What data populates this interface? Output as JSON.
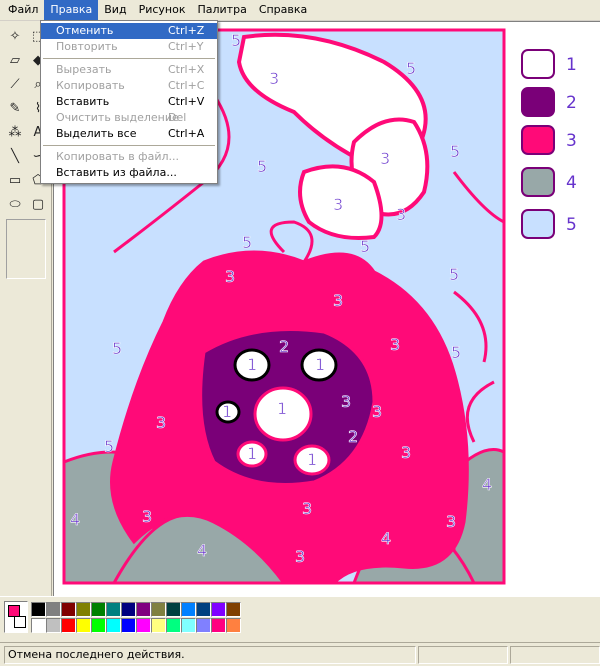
{
  "menubar": {
    "items": [
      "Файл",
      "Правка",
      "Вид",
      "Рисунок",
      "Палитра",
      "Справка"
    ]
  },
  "edit_menu": {
    "items": [
      {
        "label": "Отменить",
        "shortcut": "Ctrl+Z"
      },
      {
        "label": "Повторить",
        "shortcut": "Ctrl+Y"
      },
      {
        "label": "Вырезать",
        "shortcut": "Ctrl+X"
      },
      {
        "label": "Копировать",
        "shortcut": "Ctrl+C"
      },
      {
        "label": "Вставить",
        "shortcut": "Ctrl+V"
      },
      {
        "label": "Очистить выделение",
        "shortcut": "Del"
      },
      {
        "label": "Выделить все",
        "shortcut": "Ctrl+A"
      },
      {
        "label": "Копировать в файл..."
      },
      {
        "label": "Вставить из файла..."
      }
    ]
  },
  "tools": {
    "icons": [
      "free-select-icon",
      "rect-select-icon",
      "eraser-icon",
      "fill-icon",
      "color-picker-icon",
      "magnifier-icon",
      "pencil-icon",
      "brush-icon",
      "airbrush-icon",
      "text-icon",
      "line-icon",
      "curve-icon",
      "rectangle-icon",
      "polygon-icon",
      "ellipse-icon",
      "rounded-rect-icon"
    ]
  },
  "legend": {
    "labels": [
      "1",
      "2",
      "3",
      "4",
      "5"
    ],
    "colors": [
      "#ffffff",
      "#7a0078",
      "#ff0a78",
      "#98a8a8",
      "#c8e0ff"
    ]
  },
  "picture": {
    "colors": {
      "one": "#ffffff",
      "two": "#7a0078",
      "three": "#ff0a78",
      "four": "#98a8a8",
      "five": "#c8e0ff",
      "outline": "#ff0a78",
      "number": "#6633cc"
    },
    "number_labels": [
      "5",
      "5",
      "3",
      "3",
      "5",
      "5",
      "3",
      "3",
      "5",
      "3",
      "5",
      "5",
      "3",
      "5",
      "3",
      "5",
      "3",
      "3",
      "1",
      "2",
      "1",
      "3",
      "1",
      "1",
      "3",
      "2",
      "1",
      "1",
      "5",
      "3",
      "3",
      "4",
      "4",
      "3",
      "4",
      "3",
      "4",
      "3"
    ]
  },
  "palette": {
    "foreground": "#ff0a78",
    "background": "#ffffff",
    "row1": [
      "#000000",
      "#808080",
      "#800000",
      "#808000",
      "#008000",
      "#008080",
      "#000080",
      "#800080",
      "#808040",
      "#004040",
      "#0080ff",
      "#004080",
      "#8000ff",
      "#804000"
    ],
    "row2": [
      "#ffffff",
      "#c0c0c0",
      "#ff0000",
      "#ffff00",
      "#00ff00",
      "#00ffff",
      "#0000ff",
      "#ff00ff",
      "#ffff80",
      "#00ff80",
      "#80ffff",
      "#8080ff",
      "#ff0080",
      "#ff8040"
    ]
  },
  "status": {
    "text": "Отмена последнего действия."
  }
}
